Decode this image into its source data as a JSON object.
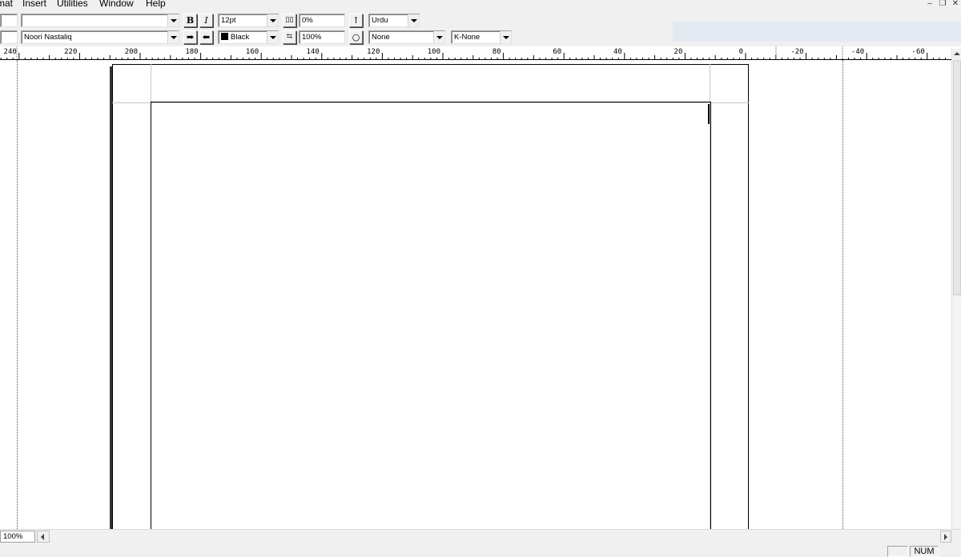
{
  "menu": {
    "items": [
      "mat",
      "Insert",
      "Utilities",
      "Window",
      "Help"
    ]
  },
  "window_controls": [
    "minimize-icon",
    "restore-icon",
    "close-icon"
  ],
  "toolbar_row1": {
    "style_combo": "",
    "bold_label": "B",
    "italic_label": "I",
    "font_size": "12pt",
    "spacing_value": "0%",
    "language": "Urdu"
  },
  "toolbar_row2": {
    "font_name": "Noori Nastaliq",
    "color_name": "Black",
    "color_hex": "#000000",
    "scale_value": "100%",
    "none_combo": "None",
    "kerning": "K-None"
  },
  "ruler": {
    "labels": [
      "240",
      "220",
      "200",
      "180",
      "160",
      "140",
      "120",
      "100",
      "80",
      "60",
      "40",
      "20",
      "0",
      "-20",
      "-40",
      "-60"
    ]
  },
  "bottom": {
    "zoom": "100%"
  },
  "status": {
    "num_lock": "NUM"
  }
}
